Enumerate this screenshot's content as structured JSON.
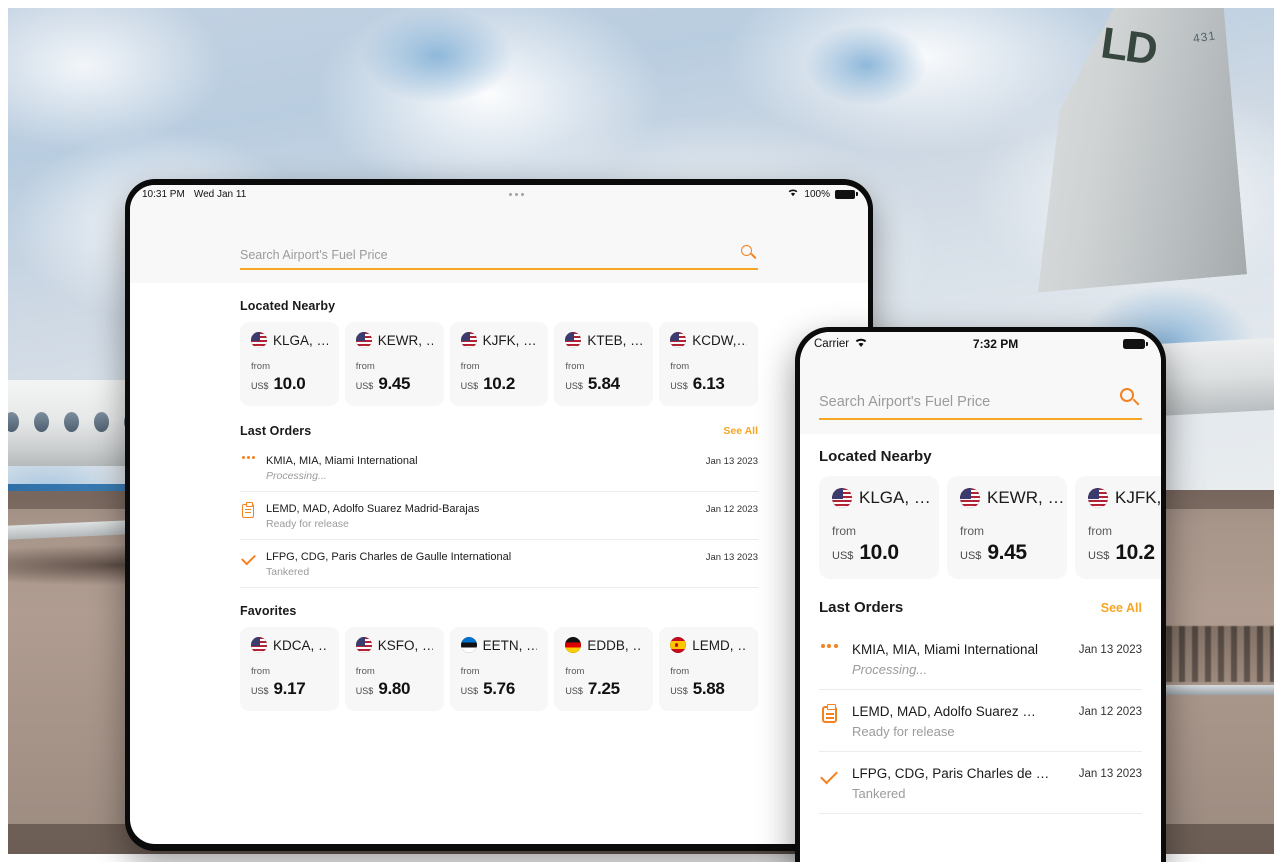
{
  "background": {
    "scene_description": "business jet on tarmac with cloudy sky",
    "tail_marking": "LD",
    "tail_number": "431"
  },
  "tablet": {
    "device": "tablet",
    "status_bar": {
      "time": "10:31 PM",
      "date": "Wed Jan 11",
      "center_indicator": "three-dots",
      "wifi_icon": "wifi-icon",
      "battery_label": "100%",
      "battery_icon": "battery-full-icon"
    },
    "search": {
      "placeholder": "Search Airport's Fuel Price",
      "value": "",
      "icon": "search-icon"
    },
    "located_nearby": {
      "title": "Located Nearby",
      "cards": [
        {
          "flag": "us",
          "code": "KLGA, …",
          "from_label": "from",
          "currency": "US$",
          "price": "10.0"
        },
        {
          "flag": "us",
          "code": "KEWR, …",
          "from_label": "from",
          "currency": "US$",
          "price": "9.45"
        },
        {
          "flag": "us",
          "code": "KJFK, …",
          "from_label": "from",
          "currency": "US$",
          "price": "10.2"
        },
        {
          "flag": "us",
          "code": "KTEB, …",
          "from_label": "from",
          "currency": "US$",
          "price": "5.84"
        },
        {
          "flag": "us",
          "code": "KCDW,…",
          "from_label": "from",
          "currency": "US$",
          "price": "6.13"
        }
      ]
    },
    "last_orders": {
      "title": "Last Orders",
      "see_all": "See All",
      "rows": [
        {
          "icon": "dots-icon",
          "title": "KMIA, MIA, Miami International",
          "status": "Processing...",
          "status_italic": true,
          "date": "Jan 13 2023"
        },
        {
          "icon": "clipboard-icon",
          "title": "LEMD, MAD, Adolfo Suarez Madrid-Barajas",
          "status": "Ready for release",
          "status_italic": false,
          "date": "Jan 12 2023"
        },
        {
          "icon": "check-icon",
          "title": "LFPG, CDG, Paris Charles de Gaulle International",
          "status": "Tankered",
          "status_italic": false,
          "date": "Jan 13 2023"
        }
      ]
    },
    "favorites": {
      "title": "Favorites",
      "cards": [
        {
          "flag": "us",
          "code": "KDCA, …",
          "from_label": "from",
          "currency": "US$",
          "price": "9.17"
        },
        {
          "flag": "us",
          "code": "KSFO, …",
          "from_label": "from",
          "currency": "US$",
          "price": "9.80"
        },
        {
          "flag": "ee",
          "code": "EETN, …",
          "from_label": "from",
          "currency": "US$",
          "price": "5.76"
        },
        {
          "flag": "de",
          "code": "EDDB, …",
          "from_label": "from",
          "currency": "US$",
          "price": "7.25"
        },
        {
          "flag": "es",
          "code": "LEMD, …",
          "from_label": "from",
          "currency": "US$",
          "price": "5.88"
        }
      ]
    }
  },
  "phone": {
    "device": "phone",
    "status_bar": {
      "carrier": "Carrier",
      "wifi_icon": "wifi-icon",
      "time": "7:32 PM",
      "battery_icon": "battery-full-icon"
    },
    "search": {
      "placeholder": "Search Airport's Fuel Price",
      "value": "",
      "icon": "search-icon"
    },
    "located_nearby": {
      "title": "Located Nearby",
      "cards": [
        {
          "flag": "us",
          "code": "KLGA, …",
          "from_label": "from",
          "currency": "US$",
          "price": "10.0"
        },
        {
          "flag": "us",
          "code": "KEWR, …",
          "from_label": "from",
          "currency": "US$",
          "price": "9.45"
        },
        {
          "flag": "us",
          "code": "KJFK, …",
          "from_label": "from",
          "currency": "US$",
          "price": "10.2"
        }
      ]
    },
    "last_orders": {
      "title": "Last Orders",
      "see_all": "See All",
      "rows": [
        {
          "icon": "dots-icon",
          "title": "KMIA, MIA, Miami International",
          "status": "Processing...",
          "status_italic": true,
          "date": "Jan 13 2023"
        },
        {
          "icon": "clipboard-icon",
          "title": "LEMD, MAD, Adolfo Suarez …",
          "status": "Ready for release",
          "status_italic": false,
          "date": "Jan 12 2023"
        },
        {
          "icon": "check-icon",
          "title": "LFPG, CDG, Paris Charles de …",
          "status": "Tankered",
          "status_italic": false,
          "date": "Jan 13 2023"
        }
      ]
    }
  },
  "colors": {
    "accent": "#F5A623",
    "accent_icon": "#F5811F",
    "card_bg": "#F7F7F7",
    "text_primary": "#1A1A1A",
    "text_muted": "#9B9B9B"
  }
}
